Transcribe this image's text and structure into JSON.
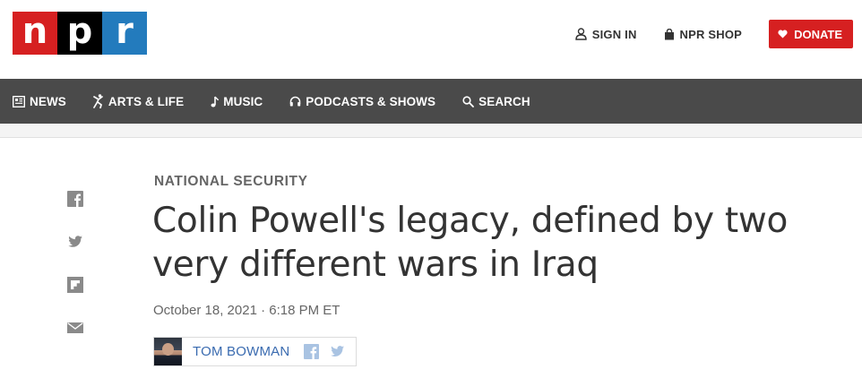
{
  "header": {
    "logo_letters": [
      "n",
      "p",
      "r"
    ],
    "logo_colors": [
      "#d62021",
      "#000000",
      "#237bbd"
    ],
    "sign_in_label": "SIGN IN",
    "shop_label": "NPR SHOP",
    "donate_label": "DONATE",
    "icons": {
      "sign_in": "user-icon",
      "shop": "shopping-bag-icon",
      "donate": "heart-icon"
    }
  },
  "nav": {
    "items": [
      {
        "label": "NEWS",
        "icon": "newspaper-icon"
      },
      {
        "label": "ARTS & LIFE",
        "icon": "dancer-icon"
      },
      {
        "label": "MUSIC",
        "icon": "music-note-icon"
      },
      {
        "label": "PODCASTS & SHOWS",
        "icon": "headphones-icon"
      },
      {
        "label": "SEARCH",
        "icon": "search-icon"
      }
    ]
  },
  "share": {
    "items": [
      "facebook-icon",
      "twitter-icon",
      "flipboard-icon",
      "email-icon"
    ]
  },
  "article": {
    "slug": "NATIONAL SECURITY",
    "headline": "Colin Powell's legacy, defined by two very different wars in Iraq",
    "date": "October 18, 2021",
    "separator": "·",
    "time": "6:18 PM ET",
    "author": "TOM BOWMAN"
  },
  "colors": {
    "nav_bg": "#4a4a4a",
    "donate": "#d62021",
    "byline_link": "#3a6bb0",
    "share_icon": "#8a8a8a",
    "byline_icon": "#a9c3e2"
  }
}
